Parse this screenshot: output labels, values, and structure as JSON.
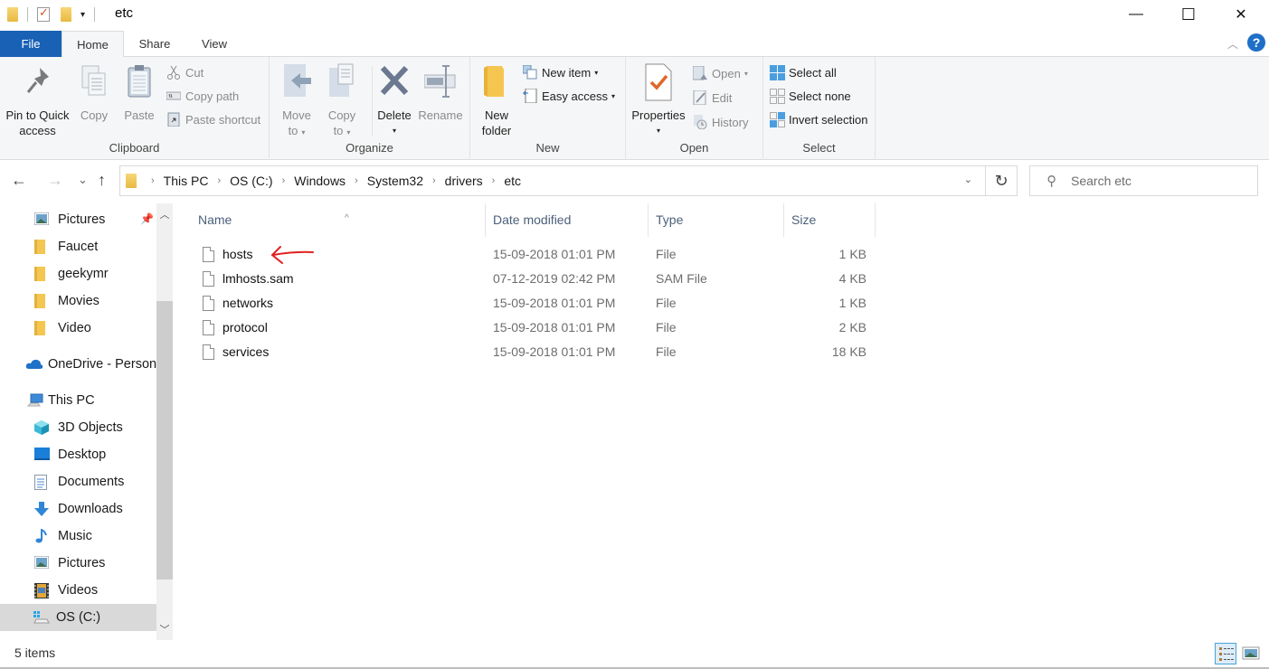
{
  "window": {
    "title": "etc",
    "controls": {
      "minimize": "—",
      "maximize": "☐",
      "close": "✕"
    }
  },
  "quick_access_toolbar": {
    "dropdown": "▾"
  },
  "ribbon": {
    "tabs": [
      {
        "label": "File"
      },
      {
        "label": "Home",
        "active": true
      },
      {
        "label": "Share"
      },
      {
        "label": "View"
      }
    ],
    "collapse": "︿",
    "help": "?",
    "groups": {
      "clipboard": {
        "label": "Clipboard",
        "pin": "Pin to Quick access",
        "pin_line1": "Pin to Quick",
        "pin_line2": "access",
        "copy": "Copy",
        "paste": "Paste",
        "cut": "Cut",
        "copy_path": "Copy path",
        "paste_shortcut": "Paste shortcut"
      },
      "organize": {
        "label": "Organize",
        "move_to_line1": "Move",
        "move_to_line2": "to",
        "copy_to_line1": "Copy",
        "copy_to_line2": "to",
        "delete": "Delete",
        "rename": "Rename"
      },
      "new": {
        "label": "New",
        "new_folder_line1": "New",
        "new_folder_line2": "folder",
        "new_item": "New item",
        "easy_access": "Easy access"
      },
      "open": {
        "label": "Open",
        "properties": "Properties",
        "open": "Open",
        "edit": "Edit",
        "history": "History"
      },
      "select": {
        "label": "Select",
        "select_all": "Select all",
        "select_none": "Select none",
        "invert_selection": "Invert selection"
      }
    }
  },
  "navigation": {
    "back": "←",
    "forward": "→",
    "recent": "⌄",
    "up": "↑",
    "breadcrumb": [
      "This PC",
      "OS (C:)",
      "Windows",
      "System32",
      "drivers",
      "etc"
    ],
    "separator": "›",
    "refresh": "↻",
    "search_placeholder": "Search etc"
  },
  "sidebar": {
    "items": [
      {
        "label": "Pictures",
        "icon": "pictures-icon",
        "pinned": true
      },
      {
        "label": "Faucet",
        "icon": "folder-icon"
      },
      {
        "label": "geekymr",
        "icon": "folder-icon"
      },
      {
        "label": "Movies",
        "icon": "folder-icon"
      },
      {
        "label": "Video",
        "icon": "folder-icon"
      },
      {
        "label": "OneDrive - Person",
        "icon": "onedrive-icon"
      },
      {
        "label": "This PC",
        "icon": "this-pc-icon"
      },
      {
        "label": "3D Objects",
        "icon": "3d-objects-icon"
      },
      {
        "label": "Desktop",
        "icon": "desktop-icon"
      },
      {
        "label": "Documents",
        "icon": "documents-icon"
      },
      {
        "label": "Downloads",
        "icon": "downloads-icon"
      },
      {
        "label": "Music",
        "icon": "music-icon"
      },
      {
        "label": "Pictures",
        "icon": "pictures-icon"
      },
      {
        "label": "Videos",
        "icon": "videos-icon"
      },
      {
        "label": "OS (C:)",
        "icon": "drive-icon",
        "selected": true
      }
    ]
  },
  "file_list": {
    "columns": [
      "Name",
      "Date modified",
      "Type",
      "Size"
    ],
    "sort_indicator": "^",
    "files": [
      {
        "name": "hosts",
        "date": "15-09-2018 01:01 PM",
        "type": "File",
        "size": "1 KB",
        "annotated": true
      },
      {
        "name": "lmhosts.sam",
        "date": "07-12-2019 02:42 PM",
        "type": "SAM File",
        "size": "4 KB"
      },
      {
        "name": "networks",
        "date": "15-09-2018 01:01 PM",
        "type": "File",
        "size": "1 KB"
      },
      {
        "name": "protocol",
        "date": "15-09-2018 01:01 PM",
        "type": "File",
        "size": "2 KB"
      },
      {
        "name": "services",
        "date": "15-09-2018 01:01 PM",
        "type": "File",
        "size": "18 KB"
      }
    ],
    "annotation_color": "#e02020"
  },
  "status_bar": {
    "item_count": "5 items"
  },
  "colors": {
    "file_tab": "#1861b5",
    "ribbon_bg": "#f5f6f7",
    "selected_nav": "#d9d9d9",
    "help": "#1f6fc7"
  }
}
